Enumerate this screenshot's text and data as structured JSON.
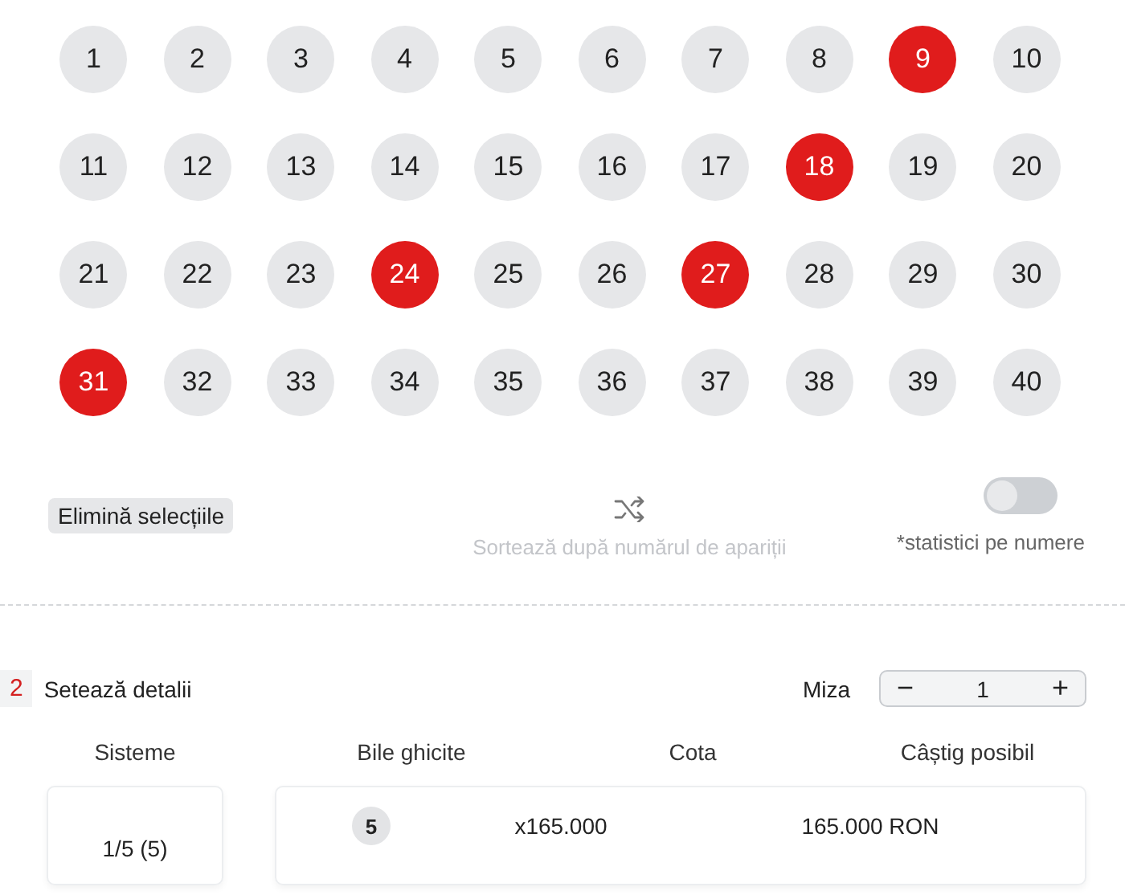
{
  "numbers": [
    {
      "label": "1",
      "selected": false
    },
    {
      "label": "2",
      "selected": false
    },
    {
      "label": "3",
      "selected": false
    },
    {
      "label": "4",
      "selected": false
    },
    {
      "label": "5",
      "selected": false
    },
    {
      "label": "6",
      "selected": false
    },
    {
      "label": "7",
      "selected": false
    },
    {
      "label": "8",
      "selected": false
    },
    {
      "label": "9",
      "selected": true
    },
    {
      "label": "10",
      "selected": false
    },
    {
      "label": "11",
      "selected": false
    },
    {
      "label": "12",
      "selected": false
    },
    {
      "label": "13",
      "selected": false
    },
    {
      "label": "14",
      "selected": false
    },
    {
      "label": "15",
      "selected": false
    },
    {
      "label": "16",
      "selected": false
    },
    {
      "label": "17",
      "selected": false
    },
    {
      "label": "18",
      "selected": true
    },
    {
      "label": "19",
      "selected": false
    },
    {
      "label": "20",
      "selected": false
    },
    {
      "label": "21",
      "selected": false
    },
    {
      "label": "22",
      "selected": false
    },
    {
      "label": "23",
      "selected": false
    },
    {
      "label": "24",
      "selected": true
    },
    {
      "label": "25",
      "selected": false
    },
    {
      "label": "26",
      "selected": false
    },
    {
      "label": "27",
      "selected": true
    },
    {
      "label": "28",
      "selected": false
    },
    {
      "label": "29",
      "selected": false
    },
    {
      "label": "30",
      "selected": false
    },
    {
      "label": "31",
      "selected": true
    },
    {
      "label": "32",
      "selected": false
    },
    {
      "label": "33",
      "selected": false
    },
    {
      "label": "34",
      "selected": false
    },
    {
      "label": "35",
      "selected": false
    },
    {
      "label": "36",
      "selected": false
    },
    {
      "label": "37",
      "selected": false
    },
    {
      "label": "38",
      "selected": false
    },
    {
      "label": "39",
      "selected": false
    },
    {
      "label": "40",
      "selected": false
    }
  ],
  "clear_button": "Elimină selecțiile",
  "sort": {
    "label": "Sortează după numărul de apariții",
    "disabled": true
  },
  "stats_toggle": {
    "label": "*statistici pe numere",
    "on": false
  },
  "section": {
    "step": "2",
    "title": "Setează detalii"
  },
  "stake": {
    "label": "Miza",
    "minus": "−",
    "value": "1",
    "plus": "+"
  },
  "table": {
    "columns": [
      "Sisteme",
      "Bile ghicite",
      "Cota",
      "Câștig posibil"
    ],
    "rows": [
      {
        "system": "1/5 (5)",
        "hits": "5",
        "odds": "x165.000",
        "win": "165.000 RON"
      }
    ]
  }
}
